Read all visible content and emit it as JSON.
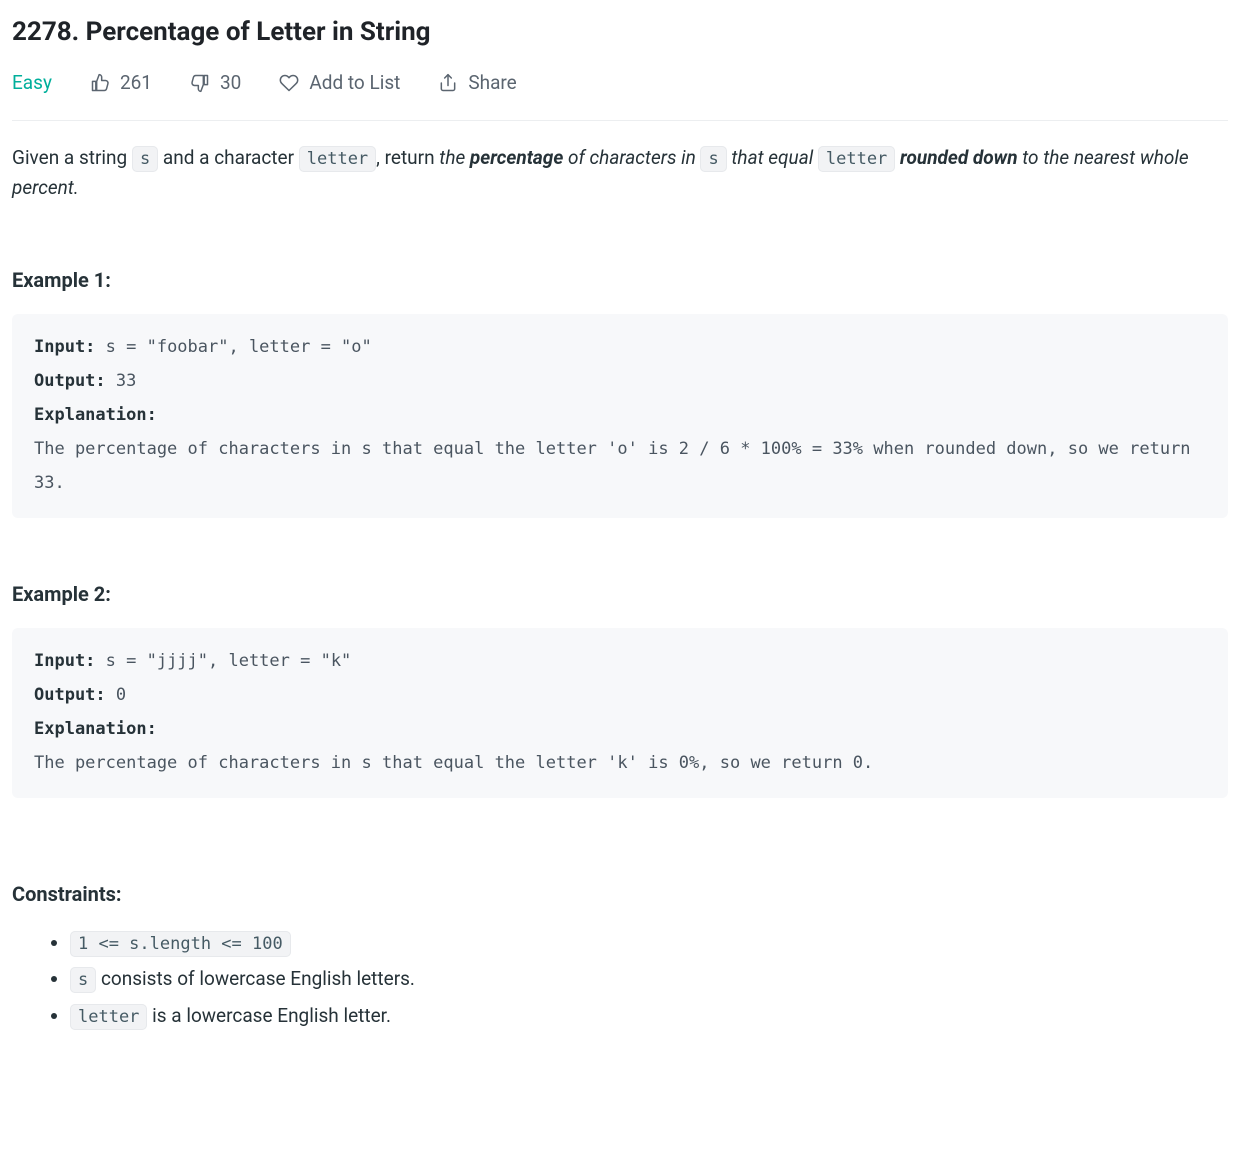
{
  "title": "2278. Percentage of Letter in String",
  "meta": {
    "difficulty": "Easy",
    "likes": "261",
    "dislikes": "30",
    "add_to_list": "Add to List",
    "share": "Share"
  },
  "desc": {
    "p1_a": "Given a string ",
    "p1_code1": "s",
    "p1_b": " and a character ",
    "p1_code2": "letter",
    "p1_c": ", return ",
    "p1_it_a": "the ",
    "p1_bold1": "percentage",
    "p1_it_b": " of characters in ",
    "p1_code3": "s",
    "p1_it_c": " that equal ",
    "p1_code4": "letter",
    "p2_bold": "rounded down",
    "p2_it": " to the nearest whole percent."
  },
  "labels": {
    "input": "Input:",
    "output": "Output:",
    "explanation": "Explanation:"
  },
  "example1": {
    "heading": "Example 1:",
    "input": " s = \"foobar\", letter = \"o\"",
    "output": " 33",
    "explanation": "The percentage of characters in s that equal the letter 'o' is 2 / 6 * 100% = 33% when rounded down, so we return 33."
  },
  "example2": {
    "heading": "Example 2:",
    "input": " s = \"jjjj\", letter = \"k\"",
    "output": " 0",
    "explanation": "The percentage of characters in s that equal the letter 'k' is 0%, so we return 0."
  },
  "constraints": {
    "heading": "Constraints:",
    "c1": "1 <= s.length <= 100",
    "c2_code": "s",
    "c2_text": " consists of lowercase English letters.",
    "c3_code": "letter",
    "c3_text": " is a lowercase English letter."
  }
}
